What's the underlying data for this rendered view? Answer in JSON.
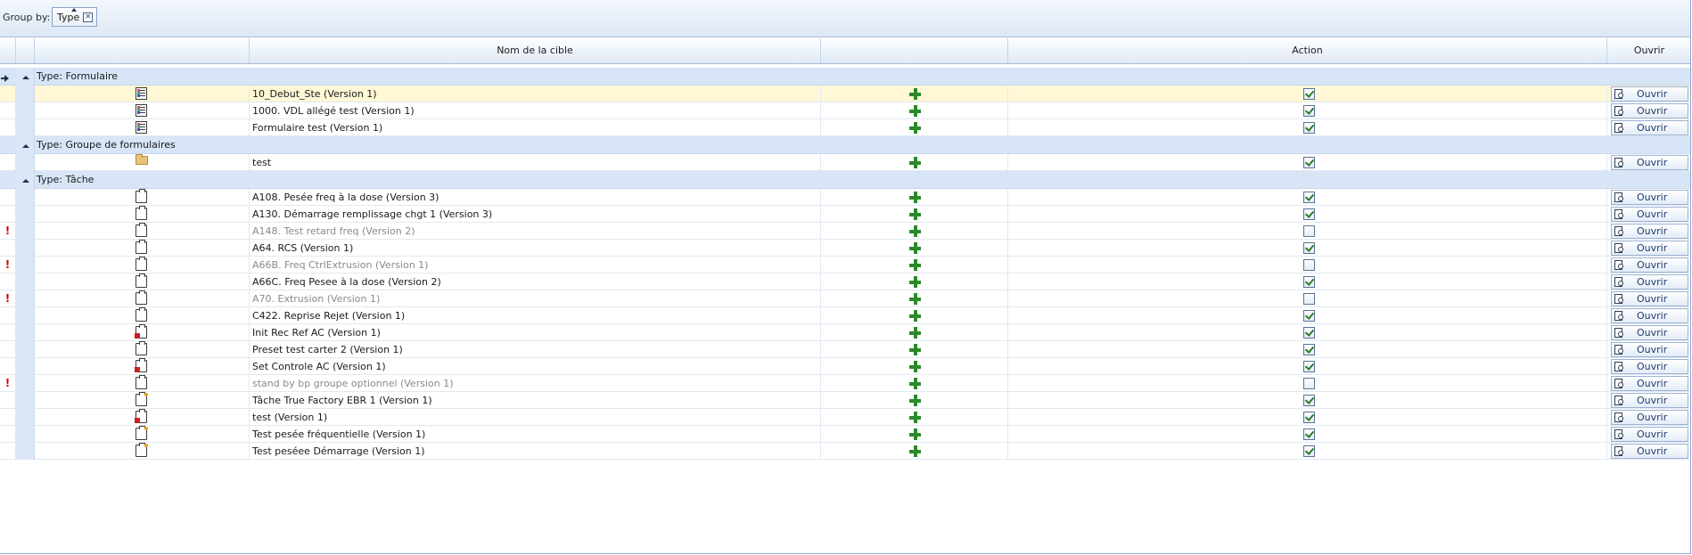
{
  "groupbar": {
    "label": "Group by:",
    "chip_label": "Type",
    "chip_remove": "✕"
  },
  "columns": {
    "name": "Nom de la cible",
    "col3": "",
    "action": "Action",
    "open": "Ouvrir"
  },
  "open_button_label": "Ouvrir",
  "groups": [
    {
      "title": "Type: Formulaire",
      "rows": [
        {
          "icon": "form-icon",
          "name": "10_Debut_Ste (Version 1)",
          "checked": true,
          "warning": "",
          "dimmed": false,
          "selected": true
        },
        {
          "icon": "form-icon",
          "name": "1000. VDL allégé test (Version 1)",
          "checked": true,
          "warning": "",
          "dimmed": false
        },
        {
          "icon": "form-icon",
          "name": "Formulaire test (Version 1)",
          "checked": true,
          "warning": "",
          "dimmed": false
        }
      ]
    },
    {
      "title": "Type: Groupe de formulaires",
      "rows": [
        {
          "icon": "folder-icon",
          "name": "test",
          "checked": true,
          "warning": "",
          "dimmed": false
        }
      ]
    },
    {
      "title": "Type: Tâche",
      "rows": [
        {
          "icon": "clipboard-icon",
          "name": "A108. Pesée freq à la dose (Version 3)",
          "checked": true,
          "warning": "",
          "dimmed": false
        },
        {
          "icon": "clipboard-icon",
          "name": "A130. Démarrage remplissage chgt 1 (Version 3)",
          "checked": true,
          "warning": "",
          "dimmed": false
        },
        {
          "icon": "clipboard-icon",
          "name": "A148. Test retard freq (Version 2)",
          "checked": false,
          "warning": "!",
          "dimmed": true
        },
        {
          "icon": "clipboard-icon",
          "name": "A64. RCS (Version 1)",
          "checked": true,
          "warning": "",
          "dimmed": false
        },
        {
          "icon": "clipboard-icon",
          "name": "A66B. Freq CtrlExtrusion (Version 1)",
          "checked": false,
          "warning": "!",
          "dimmed": true
        },
        {
          "icon": "clipboard-icon",
          "name": "A66C. Freq Pesee à la dose (Version 2)",
          "checked": true,
          "warning": "",
          "dimmed": false
        },
        {
          "icon": "clipboard-icon",
          "name": "A70. Extrusion (Version 1)",
          "checked": false,
          "warning": "!",
          "dimmed": true
        },
        {
          "icon": "clipboard-icon",
          "name": "C422. Reprise Rejet (Version 1)",
          "checked": true,
          "warning": "",
          "dimmed": false
        },
        {
          "icon": "clipboard-lock-icon",
          "name": "Init Rec Ref AC (Version 1)",
          "checked": true,
          "warning": "",
          "dimmed": false
        },
        {
          "icon": "clipboard-icon",
          "name": "Preset test carter 2 (Version 1)",
          "checked": true,
          "warning": "",
          "dimmed": false
        },
        {
          "icon": "clipboard-lock-icon",
          "name": "Set Controle AC (Version 1)",
          "checked": true,
          "warning": "",
          "dimmed": false
        },
        {
          "icon": "clipboard-icon",
          "name": "stand by bp groupe optionnel (Version 1)",
          "checked": false,
          "warning": "!",
          "dimmed": true
        },
        {
          "icon": "clipboard-star-icon",
          "name": "Tâche True Factory EBR 1 (Version 1)",
          "checked": true,
          "warning": "",
          "dimmed": false
        },
        {
          "icon": "clipboard-lock-icon",
          "name": "test (Version 1)",
          "checked": true,
          "warning": "",
          "dimmed": false
        },
        {
          "icon": "clipboard-star-icon",
          "name": "Test pesée fréquentielle (Version 1)",
          "checked": true,
          "warning": "",
          "dimmed": false
        },
        {
          "icon": "clipboard-star-icon",
          "name": "Test peséee Démarrage (Version 1)",
          "checked": true,
          "warning": "",
          "dimmed": false
        }
      ]
    }
  ]
}
